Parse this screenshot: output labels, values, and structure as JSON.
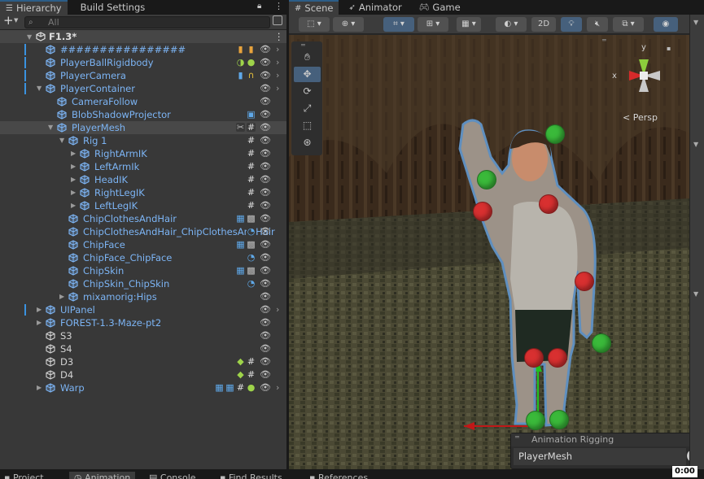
{
  "hierarchy": {
    "tabs": [
      "Hierarchy",
      "Build Settings"
    ],
    "add_label": "+",
    "search_placeholder": "All",
    "scene_name": "F1.3*",
    "rows": [
      {
        "name": "################",
        "indent": 0,
        "fold": "",
        "type": "prefab",
        "icons": [
          "audio",
          "audio"
        ],
        "chevron": true,
        "marked": true
      },
      {
        "name": "PlayerBallRigidbody",
        "indent": 0,
        "fold": "",
        "type": "prefab",
        "icons": [
          "physics",
          "collider"
        ],
        "chevron": true,
        "marked": true
      },
      {
        "name": "PlayerCamera",
        "indent": 0,
        "fold": "",
        "type": "prefab",
        "icons": [
          "camera",
          "listener"
        ],
        "chevron": true,
        "marked": true
      },
      {
        "name": "PlayerContainer",
        "indent": 0,
        "fold": "▼",
        "type": "prefab",
        "icons": [],
        "chevron": true,
        "marked": true
      },
      {
        "name": "CameraFollow",
        "indent": 1,
        "fold": "",
        "type": "prefab",
        "icons": [],
        "chevron": false,
        "marked": false
      },
      {
        "name": "BlobShadowProjector",
        "indent": 1,
        "fold": "",
        "type": "prefab",
        "icons": [
          "projector"
        ],
        "chevron": false,
        "marked": false
      },
      {
        "name": "PlayerMesh",
        "indent": 1,
        "fold": "▼",
        "type": "prefab",
        "icons": [
          "rig",
          "script"
        ],
        "chevron": false,
        "marked": false,
        "selected": true
      },
      {
        "name": "Rig 1",
        "indent": 2,
        "fold": "▼",
        "type": "prefab",
        "icons": [
          "script"
        ],
        "chevron": false,
        "marked": false
      },
      {
        "name": "RightArmIK",
        "indent": 3,
        "fold": "▶",
        "type": "prefab",
        "icons": [
          "script"
        ],
        "chevron": false,
        "marked": false
      },
      {
        "name": "LeftArmIk",
        "indent": 3,
        "fold": "▶",
        "type": "prefab",
        "icons": [
          "script"
        ],
        "chevron": false,
        "marked": false
      },
      {
        "name": "HeadIK",
        "indent": 3,
        "fold": "▶",
        "type": "prefab",
        "icons": [
          "script"
        ],
        "chevron": false,
        "marked": false
      },
      {
        "name": "RightLegIK",
        "indent": 3,
        "fold": "▶",
        "type": "prefab",
        "icons": [
          "script"
        ],
        "chevron": false,
        "marked": false
      },
      {
        "name": "LeftLegIK",
        "indent": 3,
        "fold": "▶",
        "type": "prefab",
        "icons": [
          "script"
        ],
        "chevron": false,
        "marked": false
      },
      {
        "name": "ChipClothesAndHair",
        "indent": 2,
        "fold": "",
        "type": "prefab",
        "icons": [
          "mesh",
          "skin"
        ],
        "chevron": false,
        "marked": false
      },
      {
        "name": "ChipClothesAndHair_ChipClothesAndHair",
        "indent": 2,
        "fold": "",
        "type": "prefab",
        "icons": [
          "mesh-renderer"
        ],
        "chevron": false,
        "marked": false
      },
      {
        "name": "ChipFace",
        "indent": 2,
        "fold": "",
        "type": "prefab",
        "icons": [
          "mesh",
          "skin"
        ],
        "chevron": false,
        "marked": false
      },
      {
        "name": "ChipFace_ChipFace",
        "indent": 2,
        "fold": "",
        "type": "prefab",
        "icons": [
          "mesh-renderer"
        ],
        "chevron": false,
        "marked": false
      },
      {
        "name": "ChipSkin",
        "indent": 2,
        "fold": "",
        "type": "prefab",
        "icons": [
          "mesh",
          "skin"
        ],
        "chevron": false,
        "marked": false
      },
      {
        "name": "ChipSkin_ChipSkin",
        "indent": 2,
        "fold": "",
        "type": "prefab",
        "icons": [
          "mesh-renderer"
        ],
        "chevron": false,
        "marked": false
      },
      {
        "name": "mixamorig:Hips",
        "indent": 2,
        "fold": "▶",
        "type": "prefab",
        "icons": [],
        "chevron": false,
        "marked": false
      },
      {
        "name": "UIPanel",
        "indent": 0,
        "fold": "▶",
        "type": "prefab",
        "icons": [],
        "chevron": true,
        "marked": true
      },
      {
        "name": "FOREST-1.3-Maze-pt2",
        "indent": 0,
        "fold": "▶",
        "type": "prefab",
        "icons": [],
        "chevron": false,
        "marked": false
      },
      {
        "name": "S3",
        "indent": 0,
        "fold": "",
        "type": "plain",
        "icons": [],
        "chevron": false,
        "marked": false
      },
      {
        "name": "S4",
        "indent": 0,
        "fold": "",
        "type": "plain",
        "icons": [],
        "chevron": false,
        "marked": false
      },
      {
        "name": "D3",
        "indent": 0,
        "fold": "",
        "type": "plain",
        "icons": [
          "box",
          "script"
        ],
        "chevron": false,
        "marked": false
      },
      {
        "name": "D4",
        "indent": 0,
        "fold": "",
        "type": "plain",
        "icons": [
          "box",
          "script"
        ],
        "chevron": false,
        "marked": false
      },
      {
        "name": "Warp",
        "indent": 0,
        "fold": "▶",
        "type": "prefab",
        "icons": [
          "mesh",
          "mesh",
          "script",
          "collider"
        ],
        "chevron": true,
        "marked": false
      }
    ]
  },
  "scene": {
    "tabs": [
      "Scene",
      "Animator",
      "Game"
    ],
    "mode_2d": "2D",
    "persp_label": "Persp",
    "gizmo_axis_y": "y",
    "gizmo_axis_x": "x",
    "animation_rigging": {
      "title": "Animation Rigging",
      "value": "PlayerMesh"
    }
  },
  "bottom_tabs": [
    "Project",
    "Animation",
    "Console",
    "Find Results",
    "References"
  ],
  "timecode": "0:00",
  "colors": {
    "accent": "#3a92e0",
    "prefab_text": "#7cb4f4",
    "selected_row": "#484848",
    "toolbar_on": "#46607c"
  }
}
